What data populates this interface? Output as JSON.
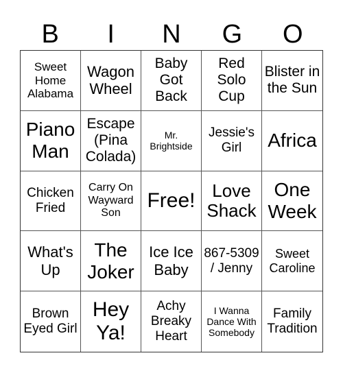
{
  "header": [
    "B",
    "I",
    "N",
    "G",
    "O"
  ],
  "cells": [
    "Sweet Home Alabama",
    "Wagon Wheel",
    "Baby Got Back",
    "Red Solo Cup",
    "Blister in the Sun",
    "Piano Man",
    "Escape (Pina Colada)",
    "Mr. Brightside",
    "Jessie's Girl",
    "Africa",
    "Chicken Fried",
    "Carry On Wayward Son",
    "Free!",
    "Love Shack",
    "One Week",
    "What's Up",
    "The Joker",
    "Ice Ice Baby",
    "867-5309 / Jenny",
    "Sweet Caroline",
    "Brown Eyed Girl",
    "Hey Ya!",
    "Achy Breaky Heart",
    "I Wanna Dance With Somebody",
    "Family Tradition"
  ]
}
